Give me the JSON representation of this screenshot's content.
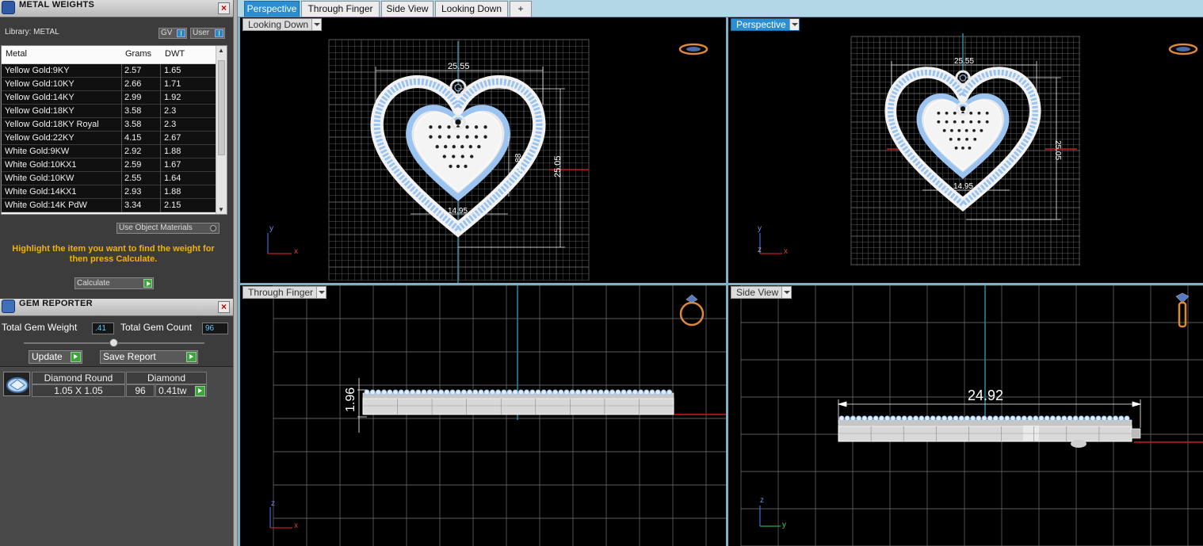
{
  "metal_weights": {
    "title": "METAL WEIGHTS",
    "close": "×",
    "library_label": "Library: METAL",
    "gv_label": "GV",
    "user_label": "User",
    "toggle_glyph": "I",
    "columns": [
      "Metal",
      "Grams",
      "DWT"
    ],
    "rows": [
      {
        "metal": "Yellow Gold:9KY",
        "grams": "2.57",
        "dwt": "1.65"
      },
      {
        "metal": "Yellow Gold:10KY",
        "grams": "2.66",
        "dwt": "1.71"
      },
      {
        "metal": "Yellow Gold:14KY",
        "grams": "2.99",
        "dwt": "1.92"
      },
      {
        "metal": "Yellow Gold:18KY",
        "grams": "3.58",
        "dwt": "2.3"
      },
      {
        "metal": "Yellow Gold:18KY Royal",
        "grams": "3.58",
        "dwt": "2.3"
      },
      {
        "metal": "Yellow Gold:22KY",
        "grams": "4.15",
        "dwt": "2.67"
      },
      {
        "metal": "White Gold:9KW",
        "grams": "2.92",
        "dwt": "1.88"
      },
      {
        "metal": "White Gold:10KX1",
        "grams": "2.59",
        "dwt": "1.67"
      },
      {
        "metal": "White Gold:10KW",
        "grams": "2.55",
        "dwt": "1.64"
      },
      {
        "metal": "White Gold:14KX1",
        "grams": "2.93",
        "dwt": "1.88"
      },
      {
        "metal": "White Gold:14K PdW",
        "grams": "3.34",
        "dwt": "2.15"
      }
    ],
    "use_object_materials": "Use Object Materials",
    "hint": "Highlight the item you want to find the weight for then press Calculate.",
    "calculate_label": "Calculate"
  },
  "gem_reporter": {
    "title": "GEM REPORTER",
    "close": "×",
    "total_weight_label": "Total Gem Weight",
    "total_weight_value": ".41",
    "total_count_label": "Total Gem Count",
    "total_count_value": "96",
    "update_label": "Update",
    "save_report_label": "Save Report",
    "gem": {
      "shape": "Diamond Round",
      "material": "Diamond",
      "size": "1.05 X 1.05",
      "count": "96",
      "weight": "0.41tw"
    }
  },
  "tabs": [
    {
      "label": "Perspective",
      "active": true
    },
    {
      "label": "Through Finger",
      "active": false
    },
    {
      "label": "Side View",
      "active": false
    },
    {
      "label": "Looking Down",
      "active": false
    }
  ],
  "add_tab": "+",
  "viewports": {
    "top_left": {
      "label": "Looking Down",
      "dims": {
        "width": "25.55",
        "height": "25.05",
        "inner_height": "11.88",
        "inner_width": "14.95"
      },
      "axes": {
        "vertical": "y",
        "horizontal": "x"
      }
    },
    "top_right": {
      "label": "Perspective",
      "dims": {
        "width": "25.55",
        "height": "25.05",
        "inner_width": "14.95"
      },
      "axes": {
        "vertical": "y",
        "horizontal": "x",
        "depth": "z"
      }
    },
    "bottom_left": {
      "label": "Through Finger",
      "dims": {
        "thickness": "1.96"
      },
      "axes": {
        "vertical": "z",
        "horizontal": "x"
      }
    },
    "bottom_right": {
      "label": "Side View",
      "dims": {
        "length": "24.92"
      },
      "axes": {
        "vertical": "z",
        "horizontal": "y"
      }
    }
  },
  "colors": {
    "accent": "#2a8ed0",
    "hint": "#f2b300",
    "grid": "#6b6b6b",
    "stone": "#9cc4f0",
    "axis_red": "#c81e1e",
    "axis_teal": "#2a8aa6",
    "orientation_icon": "#e0883a"
  },
  "icons": [
    "metal-weights-panel-icon",
    "gem-reporter-panel-icon",
    "close-icon",
    "go-arrow-icon",
    "ring-orientation-icon",
    "gem-thumbnail-icon"
  ]
}
